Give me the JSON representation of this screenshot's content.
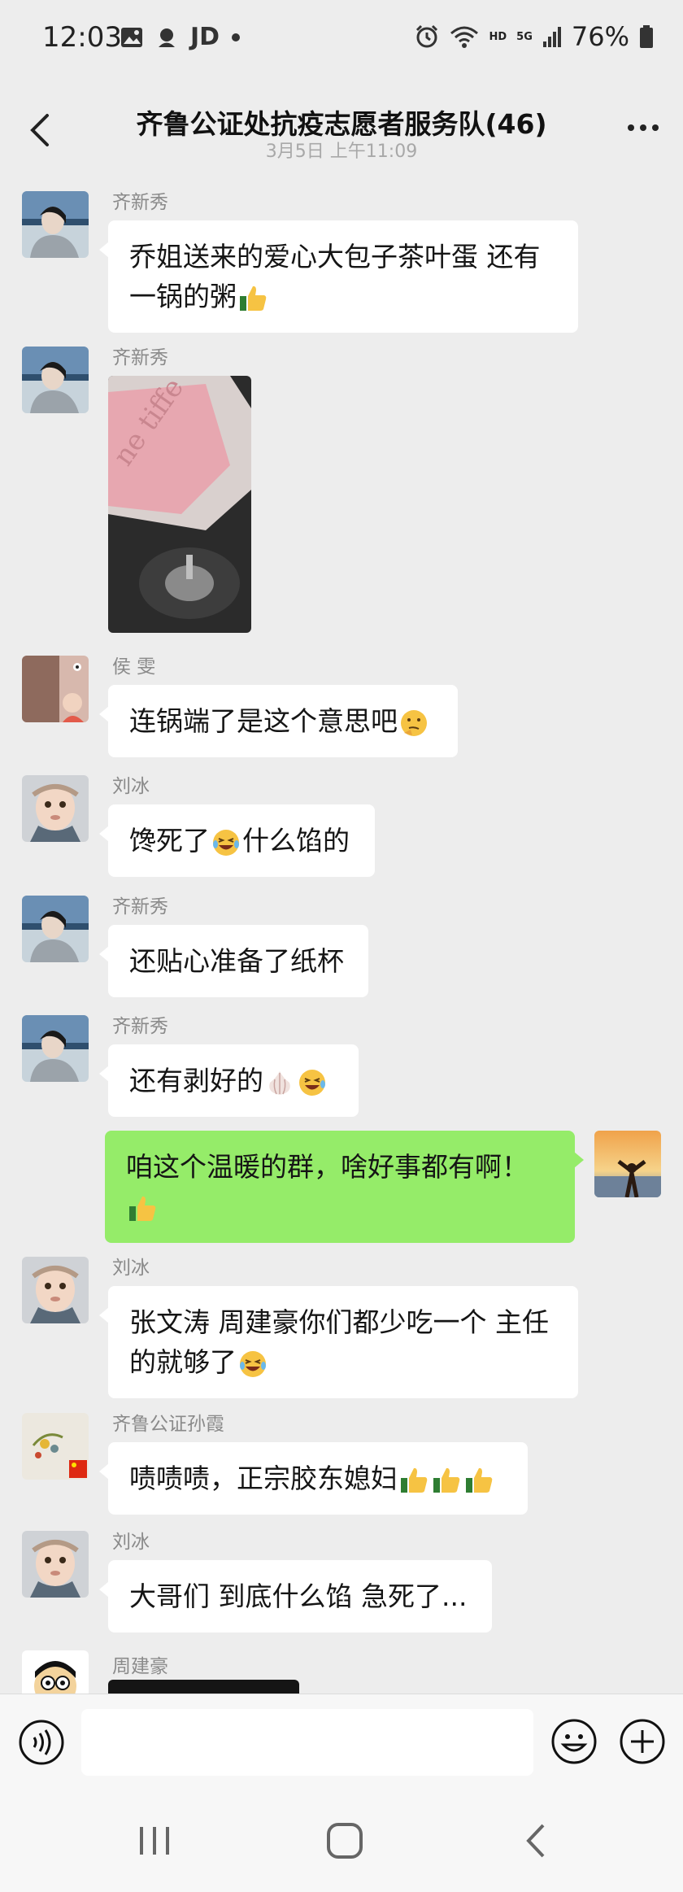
{
  "status_bar": {
    "time": "12:03",
    "carrier": "JD",
    "hd": "HD",
    "net": "5G",
    "battery": "76%"
  },
  "header": {
    "title": "齐鲁公证处抗疫志愿者服务队(46)",
    "timestamp": "3月5日 上午11:09"
  },
  "messages": [
    {
      "sender": "齐新秀",
      "text": "乔姐送来的爱心大包子茶叶蛋 还有",
      "text2": "一锅的粥",
      "emoji": "thumbs-up"
    },
    {
      "sender": "齐新秀",
      "image_text": "ne tiffe"
    },
    {
      "sender": "侯 雯",
      "text": "连锅端了是这个意思吧",
      "emoji": "thinking-face"
    },
    {
      "sender": "刘冰",
      "text_pre": "馋死了",
      "text_post": "什么馅的",
      "emoji": "laughing-face"
    },
    {
      "sender": "齐新秀",
      "text": "还贴心准备了纸杯"
    },
    {
      "sender": "齐新秀",
      "text": "还有剥好的",
      "emoji": "garlic"
    },
    {
      "sender": "me",
      "text": "咱这个温暖的群，啥好事都有啊！"
    },
    {
      "sender": "刘冰",
      "text": "张文涛 周建豪你们都少吃一个  主任",
      "text2": "的就够了"
    },
    {
      "sender": "齐鲁公证孙霞",
      "text": "啧啧啧，正宗胶东媳妇"
    },
    {
      "sender": "刘冰",
      "text": "大哥们 到底什么馅 急死了..."
    },
    {
      "sender": "周建豪"
    }
  ],
  "colors": {
    "background": "#ededed",
    "incoming_bubble": "#ffffff",
    "outgoing_bubble": "#95ec69"
  }
}
